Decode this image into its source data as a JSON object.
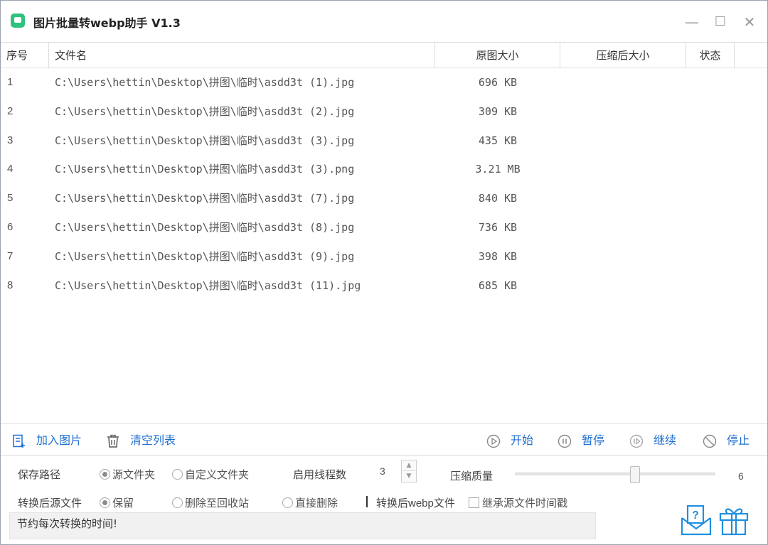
{
  "app": {
    "title": "图片批量转webp助手 V1.3",
    "accent_color": "#1f6fd1",
    "icon_color": "#2ec27e"
  },
  "window_controls": {
    "minimize": "—",
    "maximize": "☐",
    "close": "✕"
  },
  "table": {
    "columns": [
      "序号",
      "文件名",
      "原图大小",
      "压缩后大小",
      "状态"
    ],
    "rows": [
      {
        "index": "1",
        "path": "C:\\Users\\hettin\\Desktop\\拼图\\临时\\asdd3t (1).jpg",
        "size": "696 KB",
        "compressed": "",
        "status": ""
      },
      {
        "index": "2",
        "path": "C:\\Users\\hettin\\Desktop\\拼图\\临时\\asdd3t (2).jpg",
        "size": "309 KB",
        "compressed": "",
        "status": ""
      },
      {
        "index": "3",
        "path": "C:\\Users\\hettin\\Desktop\\拼图\\临时\\asdd3t (3).jpg",
        "size": "435 KB",
        "compressed": "",
        "status": ""
      },
      {
        "index": "4",
        "path": "C:\\Users\\hettin\\Desktop\\拼图\\临时\\asdd3t (3).png",
        "size": "3.21 MB",
        "compressed": "",
        "status": ""
      },
      {
        "index": "5",
        "path": "C:\\Users\\hettin\\Desktop\\拼图\\临时\\asdd3t (7).jpg",
        "size": "840 KB",
        "compressed": "",
        "status": ""
      },
      {
        "index": "6",
        "path": "C:\\Users\\hettin\\Desktop\\拼图\\临时\\asdd3t (8).jpg",
        "size": "736 KB",
        "compressed": "",
        "status": ""
      },
      {
        "index": "7",
        "path": "C:\\Users\\hettin\\Desktop\\拼图\\临时\\asdd3t (9).jpg",
        "size": "398 KB",
        "compressed": "",
        "status": ""
      },
      {
        "index": "8",
        "path": "C:\\Users\\hettin\\Desktop\\拼图\\临时\\asdd3t (11).jpg",
        "size": "685 KB",
        "compressed": "",
        "status": ""
      }
    ]
  },
  "actions": {
    "add_images": "加入图片",
    "clear_list": "清空列表",
    "start": "开始",
    "pause": "暂停",
    "resume": "继续",
    "stop": "停止"
  },
  "settings": {
    "save_path_label": "保存路径",
    "save_path_options": [
      "源文件夹",
      "自定义文件夹"
    ],
    "save_path_selected": "源文件夹",
    "threads_label": "启用线程数",
    "threads_value": "3",
    "quality_label": "压缩质量",
    "quality_value": "6",
    "quality_fraction": 0.6,
    "source_after_label": "转换后源文件",
    "source_after_options": [
      "保留",
      "删除至回收站",
      "直接删除"
    ],
    "source_after_selected": "保留",
    "webp_after_label": "转换后webp文件",
    "inherit_timestamp_label": "继承源文件时间戳",
    "inherit_timestamp_checked": false
  },
  "status": {
    "message": "节约每次转换的时间!"
  },
  "bottom_icons": [
    "help-mail-icon",
    "gift-icon"
  ]
}
